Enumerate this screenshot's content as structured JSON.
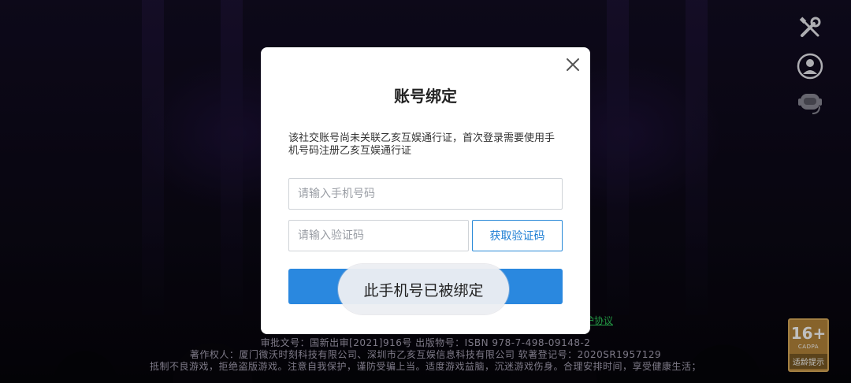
{
  "background": {
    "footer_link": "护协议",
    "footer_line_0": "...",
    "footer_line_1": "审批文号：国新出审[2021]916号 出版物号：ISBN 978-7-498-09148-2",
    "footer_line_2": "著作权人：厦门微沃时刻科技有限公司、深圳市乙亥互娱信息科技有限公司 软著登记号：2020SR1957129",
    "footer_line_3": "抵制不良游戏，拒绝盗版游戏。注意自我保护，谨防受骗上当。适度游戏益脑，沉迷游戏伤身。合理安排时间，享受健康生活；"
  },
  "side_icons": [
    "tools-icon",
    "user-icon",
    "customer-service-icon"
  ],
  "age_rating": {
    "age": "16+",
    "org": "CADPA",
    "tip": "适龄提示"
  },
  "modal": {
    "title": "账号绑定",
    "description": "该社交账号尚未关联乙亥互娱通行证，首次登录需要使用手机号码注册乙亥互娱通行证",
    "phone_placeholder": "请输入手机号码",
    "code_placeholder": "请输入验证码",
    "get_code_label": "获取验证码",
    "submit_label": ""
  },
  "toast": {
    "message": "此手机号已被绑定"
  },
  "colors": {
    "primary": "#2a88df",
    "link_green": "#2ec85a",
    "badge_gold": "#b4843a"
  }
}
